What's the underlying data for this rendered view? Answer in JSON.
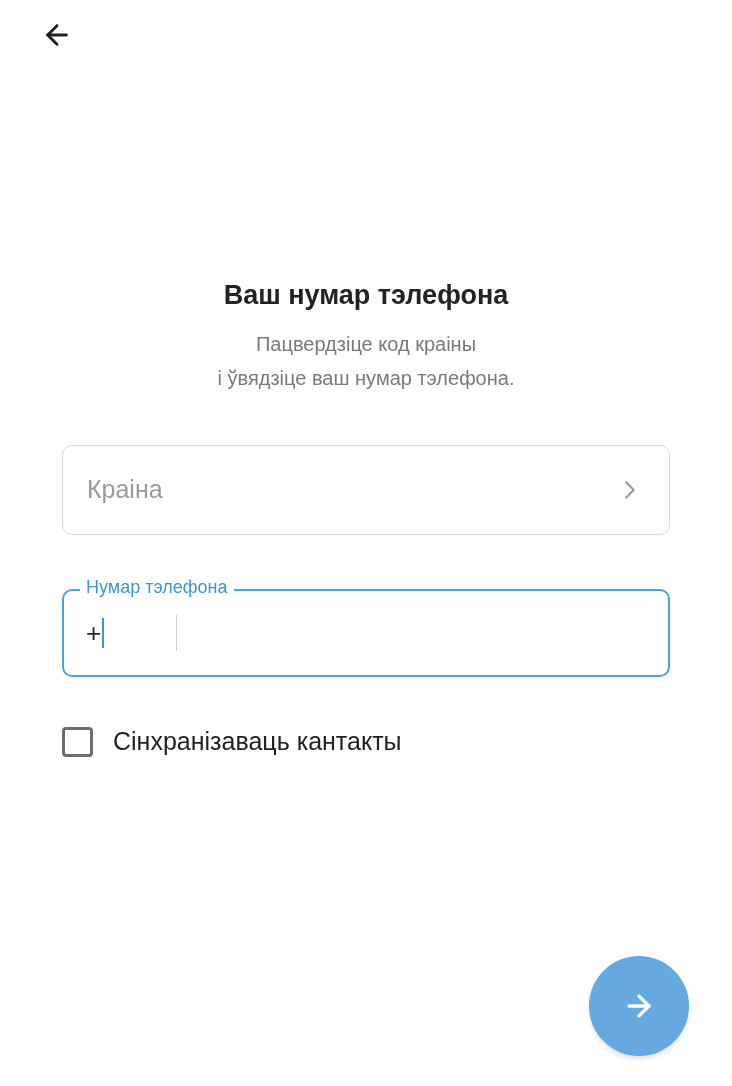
{
  "title": "Ваш нумар тэлефона",
  "subtitle": [
    "Пацвердзіце код краіны",
    "і ўвядзіце ваш нумар тэлефона."
  ],
  "country_field": {
    "placeholder": "Краіна"
  },
  "phone_field": {
    "label": "Нумар тэлефона",
    "code": "+",
    "focused": true
  },
  "sync_contacts": {
    "label": "Сінхранізаваць кантакты",
    "checked": false
  }
}
